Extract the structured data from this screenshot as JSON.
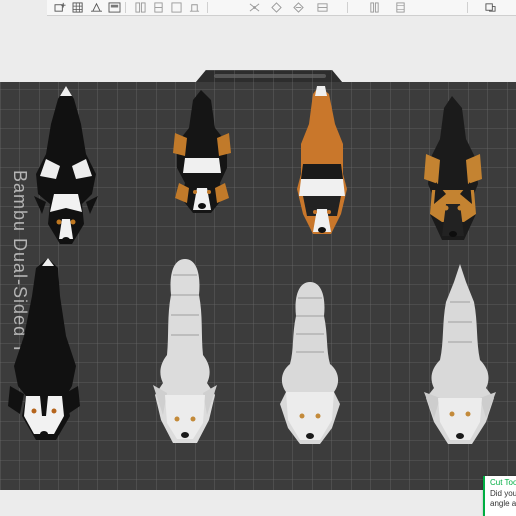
{
  "toolbar": {
    "buttons": [
      {
        "name": "add-plate-icon"
      },
      {
        "name": "arrange-grid-icon"
      },
      {
        "name": "orient-icon"
      },
      {
        "name": "plate-settings-icon"
      },
      {
        "name": "move-icon"
      },
      {
        "name": "rotate-icon"
      },
      {
        "name": "scale-icon"
      },
      {
        "name": "lay-on-face-icon"
      },
      {
        "name": "cut-icon"
      },
      {
        "name": "support-paint-icon"
      },
      {
        "name": "color-paint-icon"
      },
      {
        "name": "seam-icon"
      },
      {
        "name": "emboss-icon"
      },
      {
        "name": "measure-icon"
      }
    ]
  },
  "plate": {
    "label": "Bambu Dual-Sided T"
  },
  "models": [
    {
      "name": "border-collie-model"
    },
    {
      "name": "bernese-model"
    },
    {
      "name": "shetland-sheepdog-model"
    },
    {
      "name": "german-shepherd-model"
    },
    {
      "name": "husky-model"
    },
    {
      "name": "white-shiba-model"
    },
    {
      "name": "white-samoyed-model"
    },
    {
      "name": "white-sheepdog-model"
    }
  ],
  "notification": {
    "title": "Cut Tool",
    "line1": "Did you",
    "line2": "angle ar"
  },
  "colors": {
    "accent": "#00ae42",
    "plate": "#3f3f3f",
    "grid": "#6a6a6a",
    "background": "#ececec"
  }
}
